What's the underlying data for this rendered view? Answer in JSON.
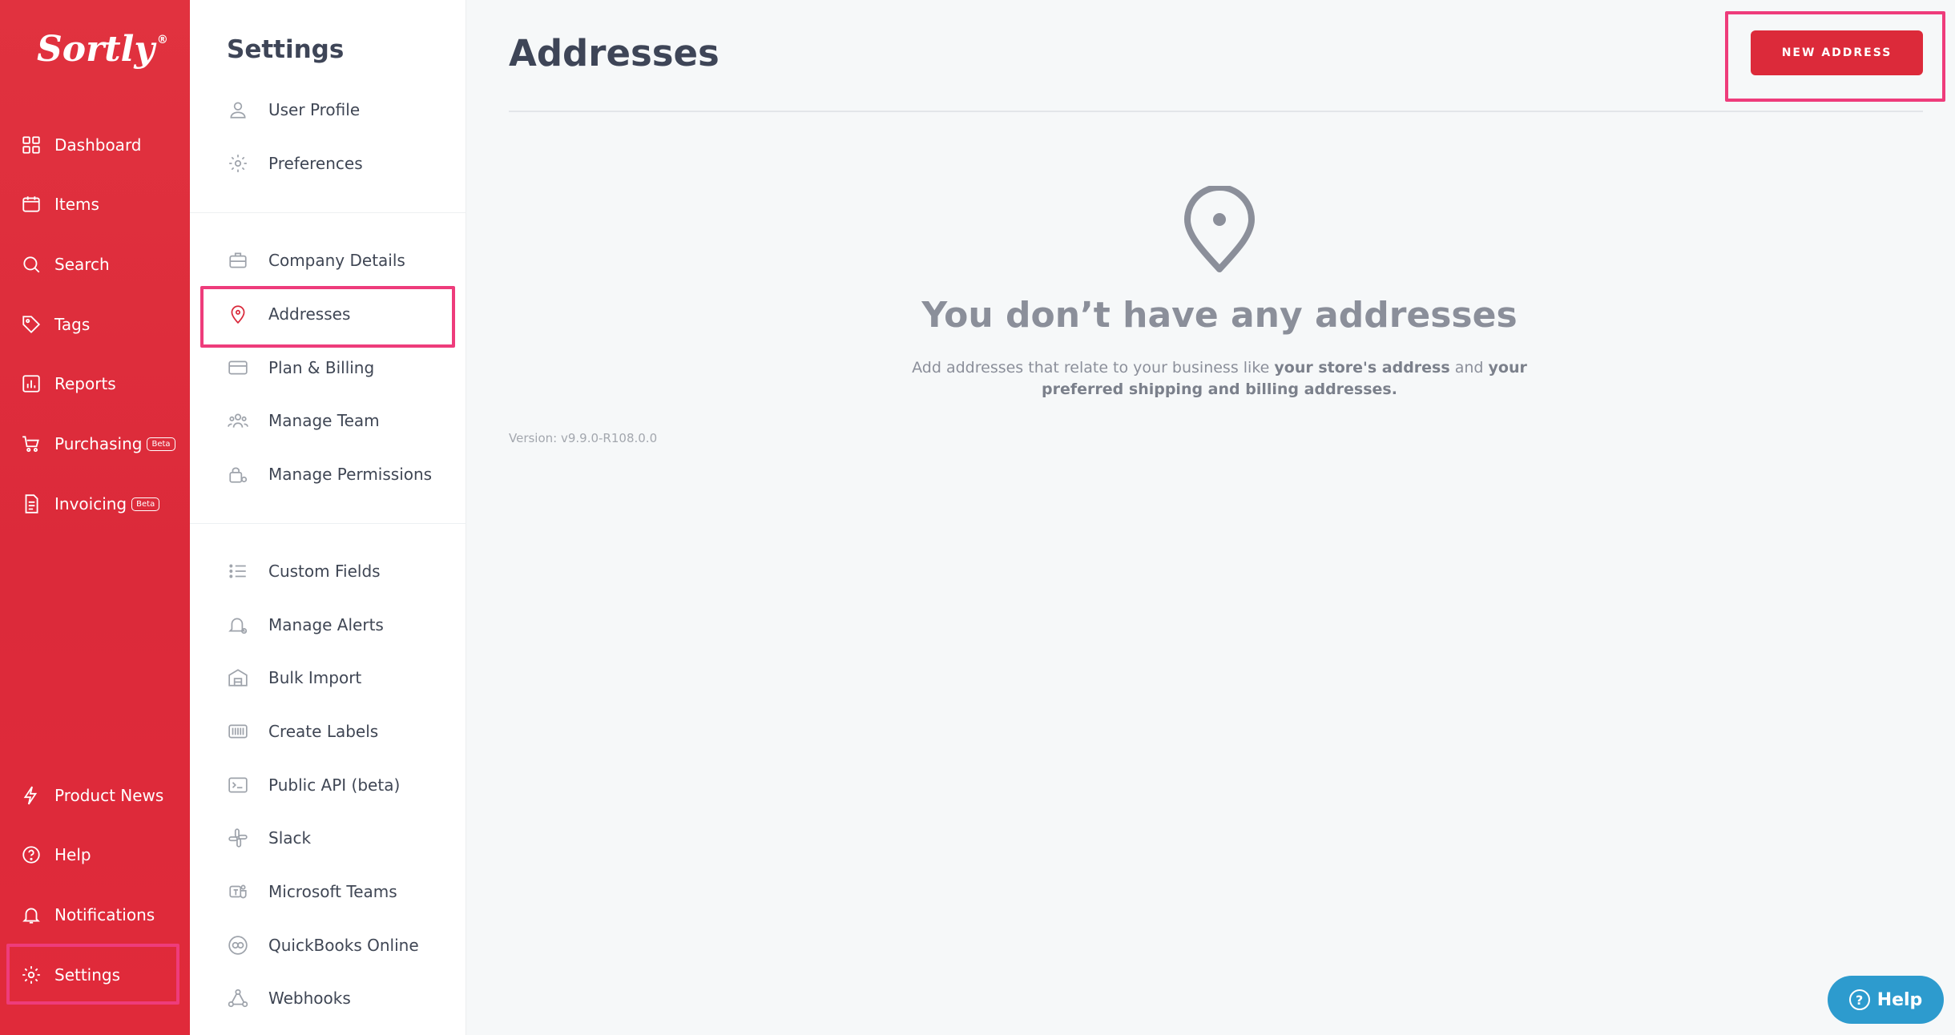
{
  "app": {
    "logo_text": "Sortly",
    "logo_mark": "®"
  },
  "leftnav": {
    "items": [
      {
        "label": "Dashboard",
        "icon": "dashboard-icon"
      },
      {
        "label": "Items",
        "icon": "folder-icon"
      },
      {
        "label": "Search",
        "icon": "search-icon"
      },
      {
        "label": "Tags",
        "icon": "tag-icon"
      },
      {
        "label": "Reports",
        "icon": "bar-chart-icon"
      },
      {
        "label": "Purchasing",
        "icon": "cart-icon",
        "badge": "Beta"
      },
      {
        "label": "Invoicing",
        "icon": "invoice-icon",
        "badge": "Beta"
      }
    ],
    "bottom": [
      {
        "label": "Product News",
        "icon": "bolt-icon"
      },
      {
        "label": "Help",
        "icon": "help-icon"
      },
      {
        "label": "Notifications",
        "icon": "bell-icon"
      },
      {
        "label": "Settings",
        "icon": "gear-icon"
      }
    ]
  },
  "settings": {
    "title": "Settings",
    "items": [
      {
        "label": "User Profile"
      },
      {
        "label": "Preferences"
      },
      {
        "label": "Company Details"
      },
      {
        "label": "Addresses"
      },
      {
        "label": "Plan & Billing"
      },
      {
        "label": "Manage Team"
      },
      {
        "label": "Manage Permissions"
      },
      {
        "label": "Custom Fields"
      },
      {
        "label": "Manage Alerts"
      },
      {
        "label": "Bulk Import"
      },
      {
        "label": "Create Labels"
      },
      {
        "label": "Public API (beta)"
      },
      {
        "label": "Slack"
      },
      {
        "label": "Microsoft Teams"
      },
      {
        "label": "QuickBooks Online"
      },
      {
        "label": "Webhooks"
      }
    ]
  },
  "main": {
    "title": "Addresses",
    "new_button": "NEW ADDRESS",
    "empty_title": "You don’t have any addresses",
    "empty_desc_1": "Add addresses that relate to your business like ",
    "empty_desc_b1": "your store's address",
    "empty_desc_2": " and ",
    "empty_desc_b2": "your preferred shipping and billing addresses.",
    "version": "Version: v9.9.0-R108.0.0"
  },
  "help_fab": {
    "label": "Help",
    "glyph": "?"
  },
  "colors": {
    "brand_red": "#dc2a3a",
    "highlight_pink": "#ee3c7b",
    "help_blue": "#2d9bce"
  }
}
